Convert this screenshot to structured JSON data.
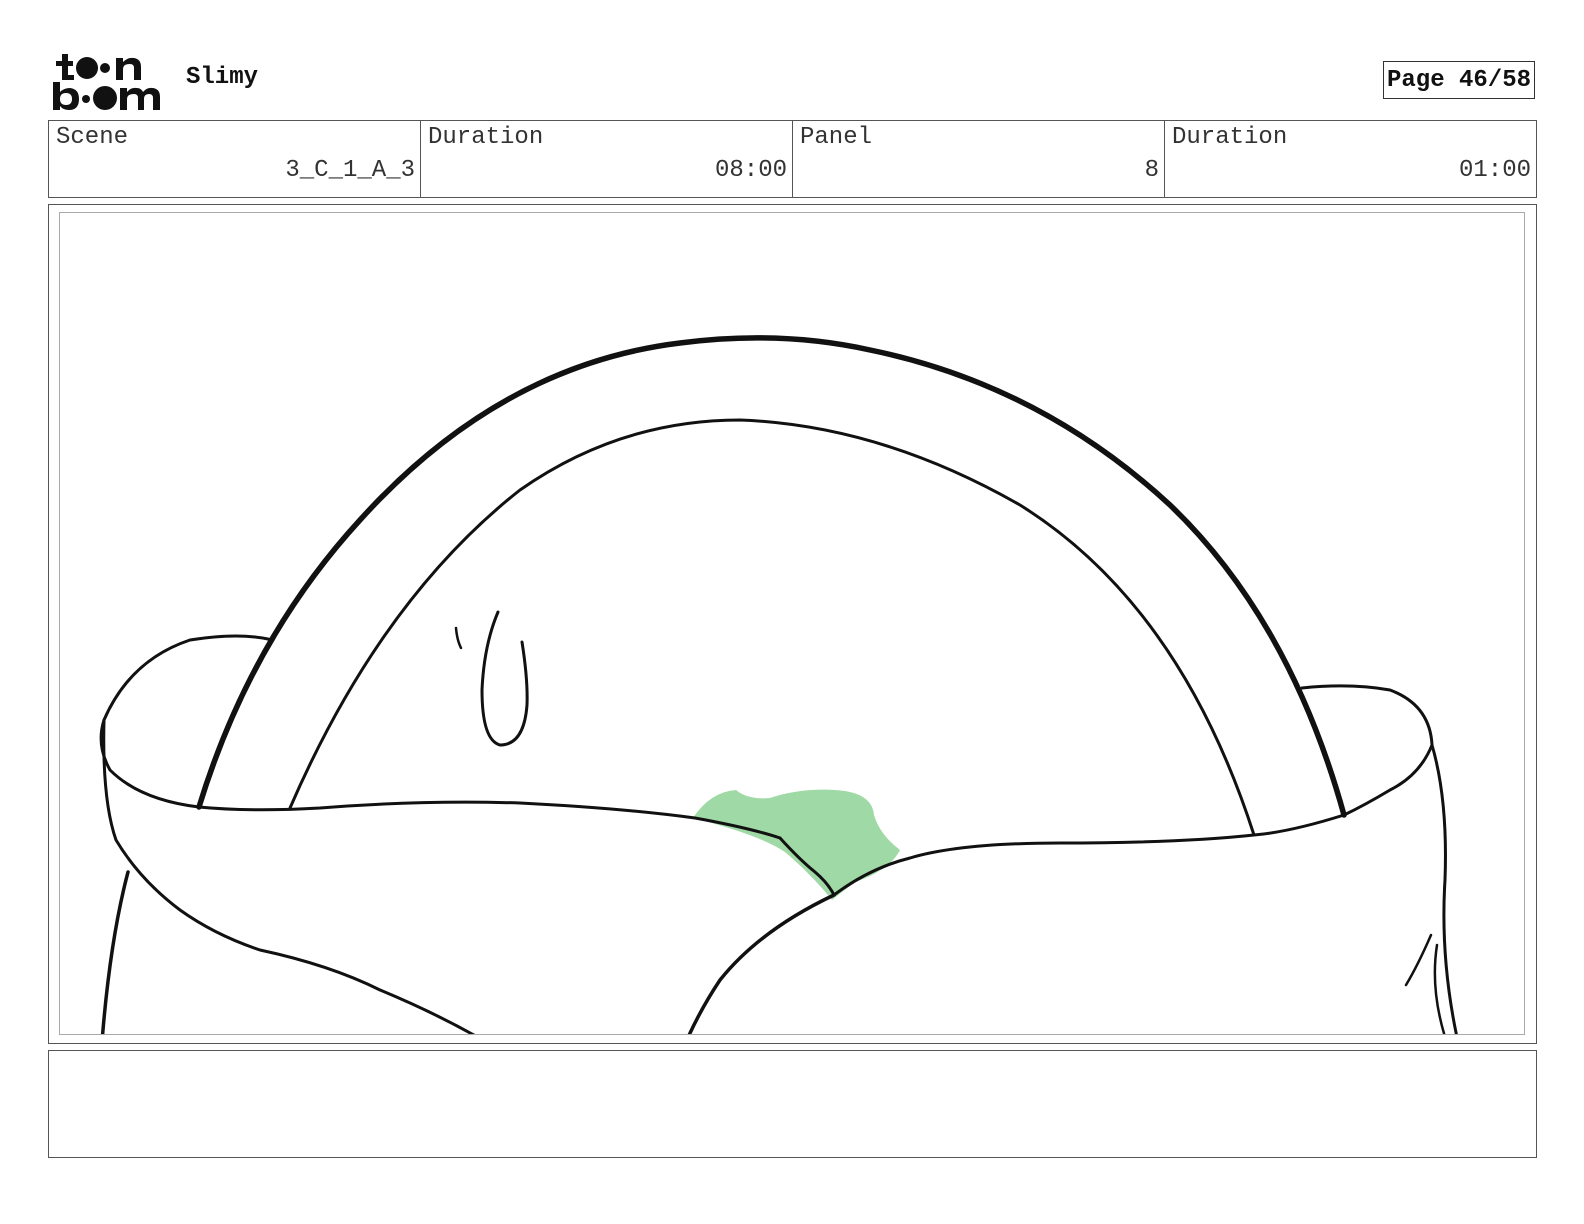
{
  "header": {
    "logo_icon": "toonboom-logo-icon",
    "project_title": "Slimy",
    "page_label": "Page 46/58"
  },
  "info": {
    "scene_label": "Scene",
    "scene_value": "3_C_1_A_3",
    "scene_duration_label": "Duration",
    "scene_duration_value": "08:00",
    "panel_label": "Panel",
    "panel_value": "8",
    "panel_duration_label": "Duration",
    "panel_duration_value": "01:00"
  },
  "drawing": {
    "slime_color": "#9fd9a5",
    "line_color": "#111111"
  },
  "notes": {
    "text": ""
  }
}
